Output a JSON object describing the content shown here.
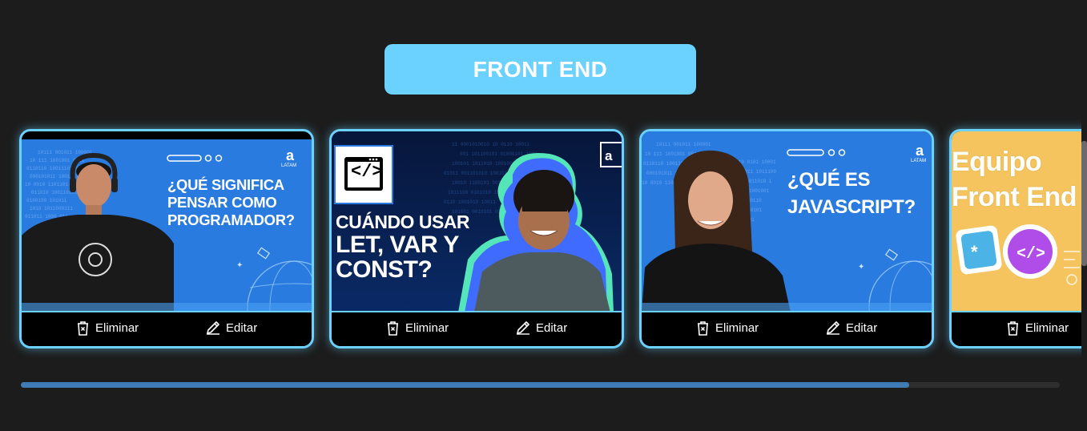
{
  "category": {
    "title": "FRONT END",
    "color": "#6bd1ff"
  },
  "cards": [
    {
      "thumb_title": "¿QUÉ SIGNIFICA\nPENSAR COMO\nPROGRAMADOR?",
      "logo_text": "LATAM",
      "delete_label": "Eliminar",
      "edit_label": "Editar"
    },
    {
      "thumb_title_small": "CUÁNDO USAR",
      "thumb_title_big": "LET, VAR Y\nCONST?",
      "code_icon": "</>",
      "delete_label": "Eliminar",
      "edit_label": "Editar"
    },
    {
      "thumb_title": "¿QUÉ ES\nJAVASCRIPT?",
      "logo_text": "LATAM",
      "delete_label": "Eliminar",
      "edit_label": "Editar"
    },
    {
      "thumb_title": "Equipo\nFront End",
      "delete_label": "Eliminar"
    }
  ],
  "scroll": {
    "horizontal_position_fraction": 0.855
  },
  "colors": {
    "accent": "#6bd1ff",
    "card_bg_blue": "#2a7be0",
    "background": "#1c1c1c",
    "orange": "#f5c45e"
  },
  "icons": {
    "delete": "trash-icon",
    "edit": "pencil-icon"
  }
}
